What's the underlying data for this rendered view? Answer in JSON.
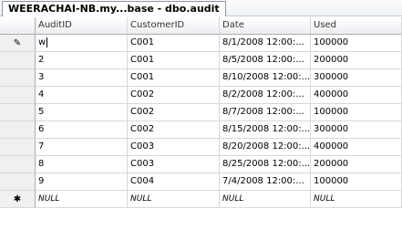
{
  "window": {
    "tab_title": "WEERACHAI-NB.my...base - dbo.audit"
  },
  "grid": {
    "columns": [
      "AuditID",
      "CustomerID",
      "Date",
      "Used"
    ],
    "selector_icons": {
      "editing": "pencil-icon",
      "new_row": "asterisk-icon"
    },
    "editing_row_glyph": "✎",
    "new_row_glyph": "✱",
    "rows": [
      {
        "audit_id": "w",
        "customer_id": "C001",
        "date": "8/1/2008 12:00:...",
        "used": "100000"
      },
      {
        "audit_id": "2",
        "customer_id": "C001",
        "date": "8/5/2008 12:00:...",
        "used": "200000"
      },
      {
        "audit_id": "3",
        "customer_id": "C001",
        "date": "8/10/2008 12:00:...",
        "used": "300000"
      },
      {
        "audit_id": "4",
        "customer_id": "C002",
        "date": "8/2/2008 12:00:...",
        "used": "400000"
      },
      {
        "audit_id": "5",
        "customer_id": "C002",
        "date": "8/7/2008 12:00:...",
        "used": "100000"
      },
      {
        "audit_id": "6",
        "customer_id": "C002",
        "date": "8/15/2008 12:00:...",
        "used": "300000"
      },
      {
        "audit_id": "7",
        "customer_id": "C003",
        "date": "8/20/2008 12:00:...",
        "used": "400000"
      },
      {
        "audit_id": "8",
        "customer_id": "C003",
        "date": "8/25/2008 12:00:...",
        "used": "200000"
      },
      {
        "audit_id": "9",
        "customer_id": "C004",
        "date": "7/4/2008 12:00:...",
        "used": "100000"
      }
    ],
    "new_row": {
      "audit_id": "NULL",
      "customer_id": "NULL",
      "date": "NULL",
      "used": "NULL"
    }
  }
}
